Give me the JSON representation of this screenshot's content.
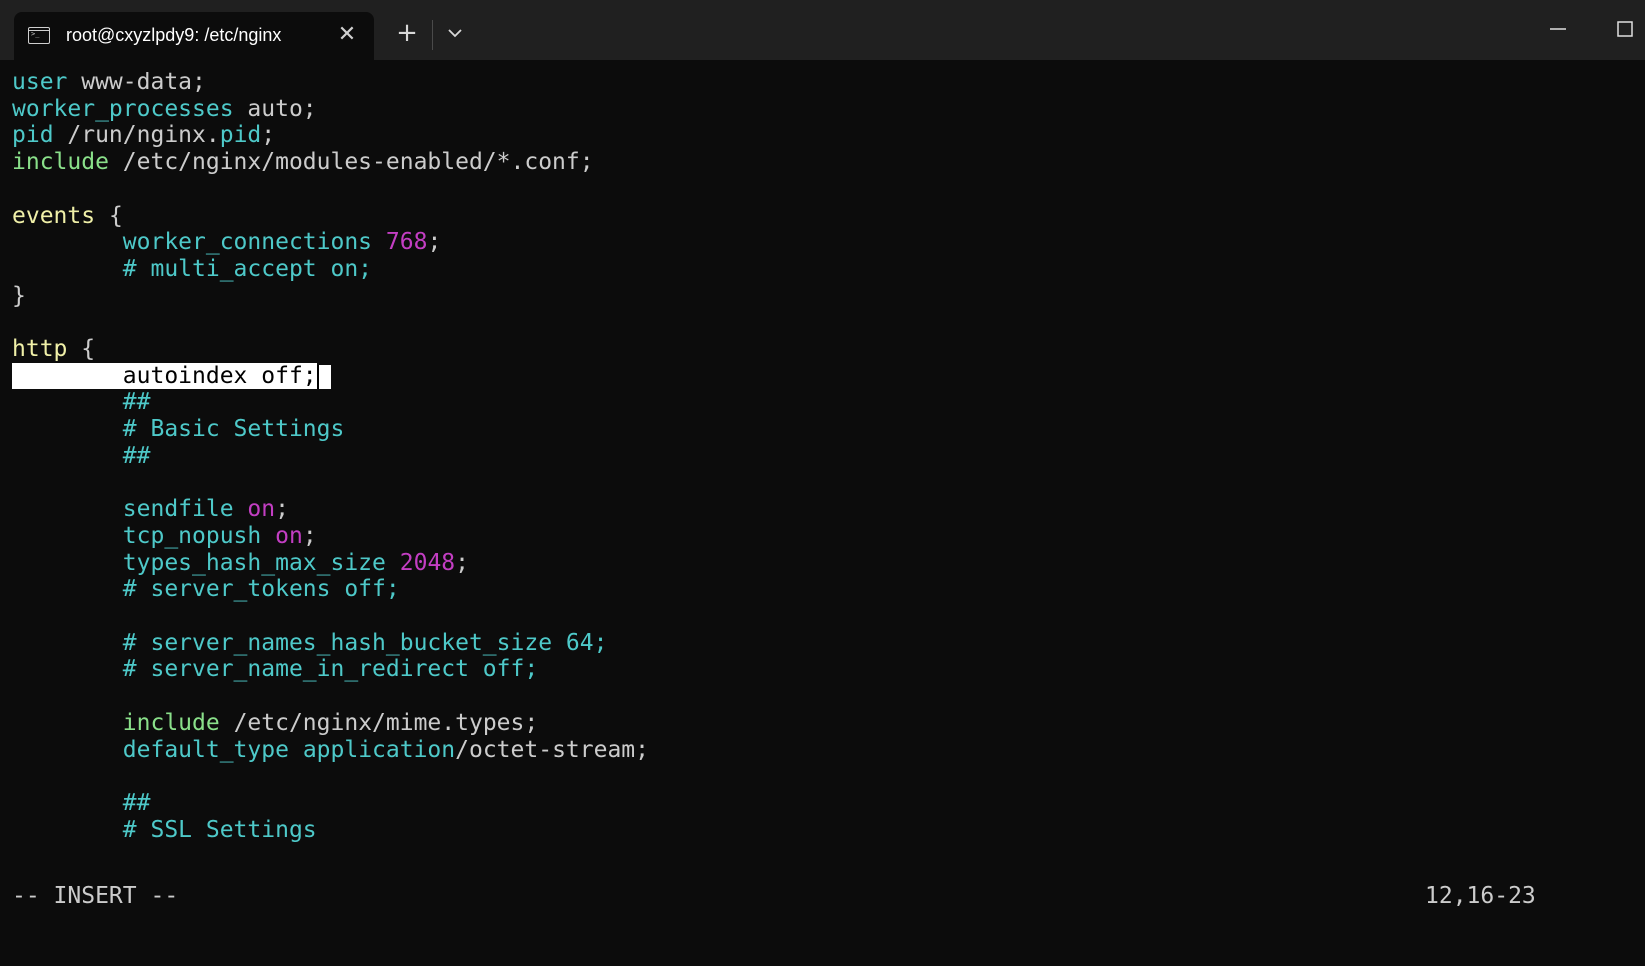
{
  "window": {
    "tab_title": "root@cxyzlpdy9: /etc/nginx",
    "tab_icon": "terminal-icon",
    "close_icon": "close-icon",
    "new_tab_icon": "plus-icon",
    "dropdown_icon": "chevron-down-icon"
  },
  "editor": {
    "lines": [
      [
        {
          "t": "user",
          "c": "kw"
        },
        {
          "t": " www-data;",
          "c": "str"
        }
      ],
      [
        {
          "t": "worker_processes",
          "c": "kw"
        },
        {
          "t": " auto;",
          "c": "str"
        }
      ],
      [
        {
          "t": "pid",
          "c": "kw"
        },
        {
          "t": " /run/nginx.",
          "c": "str"
        },
        {
          "t": "pid",
          "c": "kw"
        },
        {
          "t": ";",
          "c": "str"
        }
      ],
      [
        {
          "t": "include",
          "c": "inc"
        },
        {
          "t": " /etc/nginx/modules-enabled/*.conf;",
          "c": "str"
        }
      ],
      [],
      [
        {
          "t": "events",
          "c": "blk"
        },
        {
          "t": " {",
          "c": "str"
        }
      ],
      [
        {
          "t": "        "
        },
        {
          "t": "worker_connections",
          "c": "kw"
        },
        {
          "t": " "
        },
        {
          "t": "768",
          "c": "num"
        },
        {
          "t": ";",
          "c": "str"
        }
      ],
      [
        {
          "t": "        "
        },
        {
          "t": "# multi_accept on;",
          "c": "cm"
        }
      ],
      [
        {
          "t": "}",
          "c": "str"
        }
      ],
      [],
      [
        {
          "t": "http",
          "c": "blk"
        },
        {
          "t": " {",
          "c": "str"
        }
      ],
      [
        {
          "t": "        autoindex off;",
          "c": "sel",
          "cursor": true
        }
      ],
      [
        {
          "t": "        "
        },
        {
          "t": "##",
          "c": "cm"
        }
      ],
      [
        {
          "t": "        "
        },
        {
          "t": "# Basic Settings",
          "c": "cm"
        }
      ],
      [
        {
          "t": "        "
        },
        {
          "t": "##",
          "c": "cm"
        }
      ],
      [],
      [
        {
          "t": "        "
        },
        {
          "t": "sendfile",
          "c": "kw"
        },
        {
          "t": " "
        },
        {
          "t": "on",
          "c": "num"
        },
        {
          "t": ";",
          "c": "str"
        }
      ],
      [
        {
          "t": "        "
        },
        {
          "t": "tcp_nopush",
          "c": "kw"
        },
        {
          "t": " "
        },
        {
          "t": "on",
          "c": "num"
        },
        {
          "t": ";",
          "c": "str"
        }
      ],
      [
        {
          "t": "        "
        },
        {
          "t": "types_hash_max_size",
          "c": "kw"
        },
        {
          "t": " "
        },
        {
          "t": "2048",
          "c": "num"
        },
        {
          "t": ";",
          "c": "str"
        }
      ],
      [
        {
          "t": "        "
        },
        {
          "t": "# server_tokens off;",
          "c": "cm"
        }
      ],
      [],
      [
        {
          "t": "        "
        },
        {
          "t": "# server_names_hash_bucket_size 64;",
          "c": "cm"
        }
      ],
      [
        {
          "t": "        "
        },
        {
          "t": "# server_name_in_redirect off;",
          "c": "cm"
        }
      ],
      [],
      [
        {
          "t": "        "
        },
        {
          "t": "include",
          "c": "inc"
        },
        {
          "t": " /etc/nginx/mime.types;",
          "c": "str"
        }
      ],
      [
        {
          "t": "        "
        },
        {
          "t": "default_type",
          "c": "kw"
        },
        {
          "t": " "
        },
        {
          "t": "application",
          "c": "kw"
        },
        {
          "t": "/octet-stream;",
          "c": "str"
        }
      ],
      [],
      [
        {
          "t": "        "
        },
        {
          "t": "##",
          "c": "cm"
        }
      ],
      [
        {
          "t": "        "
        },
        {
          "t": "# SSL Settings",
          "c": "cm"
        }
      ]
    ]
  },
  "status": {
    "mode": "-- INSERT --",
    "position": "12,16-23"
  },
  "colors": {
    "background": "#0c0c0c",
    "keyword": "#4ec9c9",
    "number": "#c33ec3",
    "include": "#8ae08a",
    "block": "#f0f0a8",
    "text": "#cccccc"
  }
}
